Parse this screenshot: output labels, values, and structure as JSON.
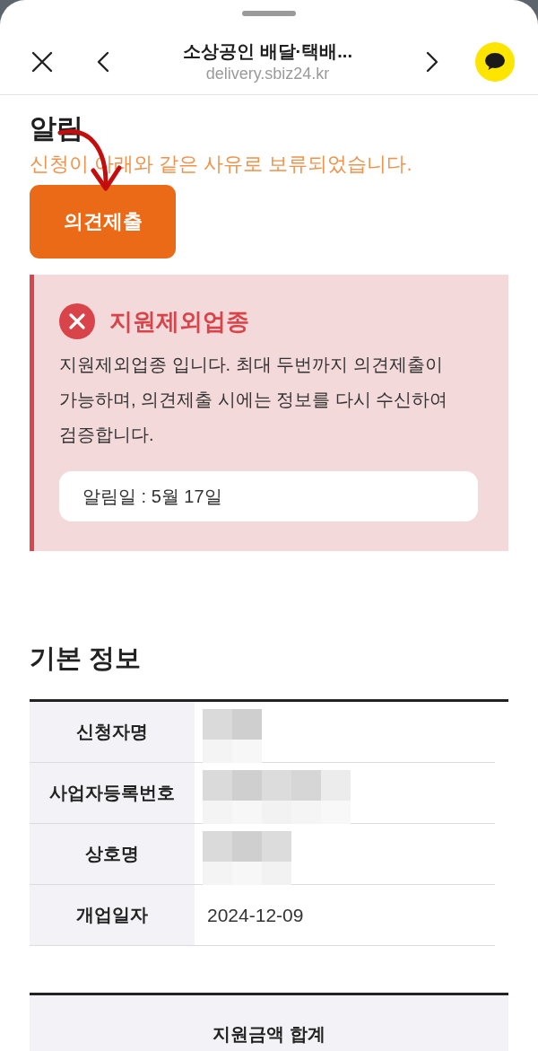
{
  "header": {
    "title": "소상공인 배달·택배...",
    "url": "delivery.sbiz24.kr"
  },
  "notice": {
    "title": "알림",
    "message": "신청이 아래와 같은 사유로 보류되었습니다.",
    "button": "의견제출"
  },
  "alert": {
    "title": "지원제외업종",
    "body": "지원제외업종 입니다. 최대 두번까지 의견제출이 가능하며, 의견제출 시에는 정보를 다시 수신하여 검증합니다.",
    "date": "알림일 : 5월 17일"
  },
  "basic_info": {
    "title": "기본 정보",
    "rows": [
      {
        "label": "신청자명",
        "redacted": true
      },
      {
        "label": "사업자등록번호",
        "redacted": true
      },
      {
        "label": "상호명",
        "redacted": true
      },
      {
        "label": "개업일자",
        "redacted": false,
        "value": "2024-12-09"
      }
    ]
  },
  "support_total": {
    "title": "지원금액 합계"
  }
}
